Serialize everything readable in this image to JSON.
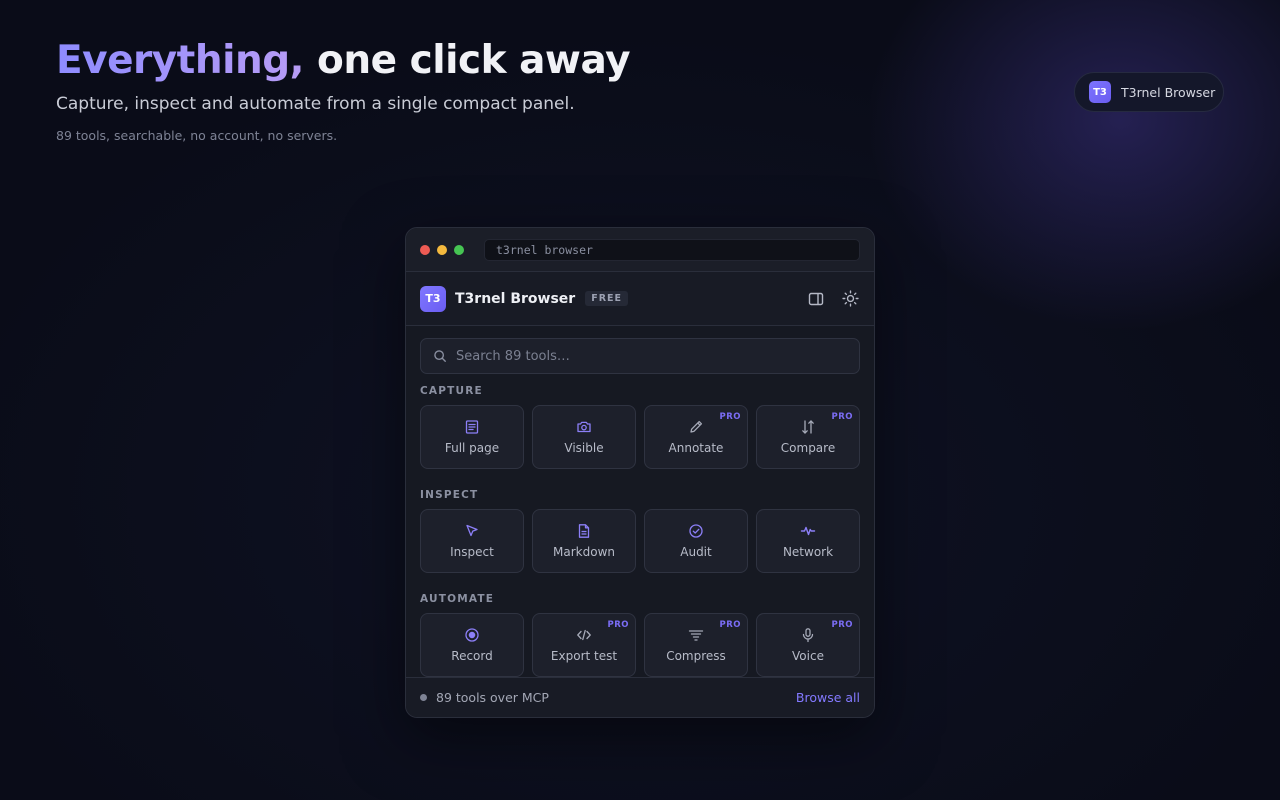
{
  "hero": {
    "title_accent": "Everything,",
    "title_rest": "one click away",
    "subtitle": "Capture, inspect and automate from a single compact panel.",
    "note": "89 tools, searchable, no account, no servers."
  },
  "brand_pill": {
    "logo": "T3",
    "label": "T3rnel Browser"
  },
  "window": {
    "address": "t3rnel browser",
    "app": {
      "logo": "T3",
      "name": "T3rnel Browser",
      "plan": "FREE"
    },
    "search": {
      "placeholder": "Search 89 tools…",
      "value": ""
    },
    "sections": [
      {
        "label": "CAPTURE",
        "tools": [
          {
            "label": "Full page",
            "icon": "document-icon",
            "pro": ""
          },
          {
            "label": "Visible",
            "icon": "camera-icon",
            "pro": ""
          },
          {
            "label": "Annotate",
            "icon": "pencil-icon",
            "pro": "PRO"
          },
          {
            "label": "Compare",
            "icon": "compare-arrows-icon",
            "pro": "PRO"
          }
        ]
      },
      {
        "label": "INSPECT",
        "tools": [
          {
            "label": "Inspect",
            "icon": "cursor-icon",
            "pro": ""
          },
          {
            "label": "Markdown",
            "icon": "file-text-icon",
            "pro": ""
          },
          {
            "label": "Audit",
            "icon": "check-circle-icon",
            "pro": ""
          },
          {
            "label": "Network",
            "icon": "activity-icon",
            "pro": ""
          }
        ]
      },
      {
        "label": "AUTOMATE",
        "tools": [
          {
            "label": "Record",
            "icon": "record-icon",
            "pro": ""
          },
          {
            "label": "Export test",
            "icon": "code-icon",
            "pro": "PRO"
          },
          {
            "label": "Compress",
            "icon": "filter-icon",
            "pro": "PRO"
          },
          {
            "label": "Voice",
            "icon": "microphone-icon",
            "pro": "PRO"
          }
        ]
      }
    ],
    "footer": {
      "status": "89 tools over MCP",
      "link": "Browse all"
    }
  },
  "colors": {
    "accent": "#7b6df5",
    "link": "#8379ff",
    "panel": "#161922"
  }
}
